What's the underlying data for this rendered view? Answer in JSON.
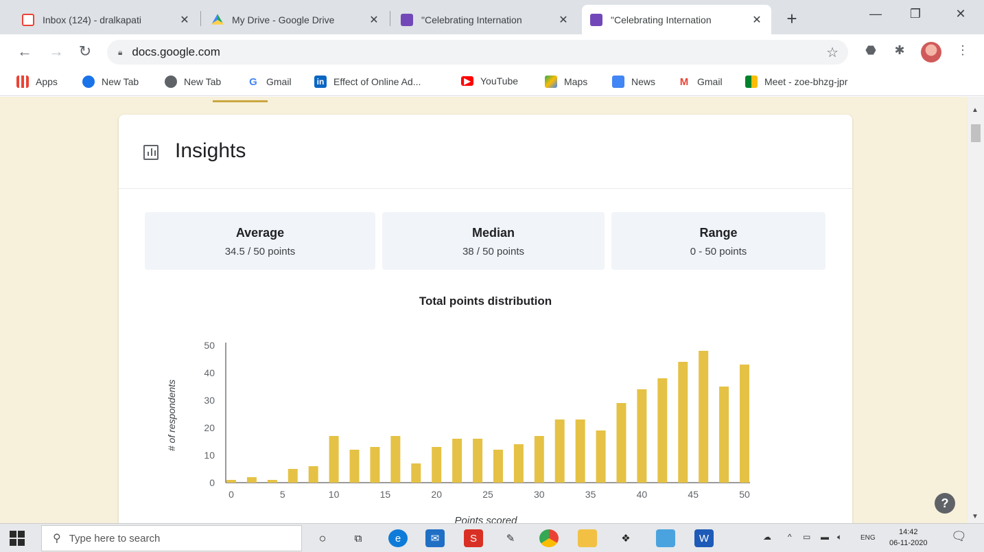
{
  "browser": {
    "tabs": [
      {
        "title": "Inbox (124) - dralkapati",
        "icon": "gmail-icon",
        "color": "#ea4335"
      },
      {
        "title": "My Drive - Google Drive",
        "icon": "google-drive-icon",
        "color": "#1fa463"
      },
      {
        "title": "\"Celebrating Internation",
        "icon": "google-forms-icon",
        "color": "#7248b9"
      },
      {
        "title": "\"Celebrating Internation",
        "icon": "google-forms-icon",
        "color": "#7248b9"
      }
    ],
    "url": "docs.google.com",
    "bookmarks": [
      {
        "label": "Apps",
        "icon": "apps-grid-icon",
        "color": "#ea4335"
      },
      {
        "label": "New Tab",
        "icon": "gear-icon",
        "color": "#1a73e8"
      },
      {
        "label": "New Tab",
        "icon": "globe-icon",
        "color": "#5f6368"
      },
      {
        "label": "Gmail",
        "icon": "google-g-icon",
        "color": "#4285f4"
      },
      {
        "label": "Effect of Online Ad...",
        "icon": "linkedin-icon",
        "color": "#0a66c2"
      },
      {
        "label": "YouTube",
        "icon": "youtube-icon",
        "color": "#ff0000"
      },
      {
        "label": "Maps",
        "icon": "maps-icon",
        "color": "#34a853"
      },
      {
        "label": "News",
        "icon": "news-icon",
        "color": "#4285f4"
      },
      {
        "label": "Gmail",
        "icon": "gmail-icon",
        "color": "#ea4335"
      },
      {
        "label": "Meet - zoe-bhzg-jpr",
        "icon": "meet-icon",
        "color": "#00832d"
      }
    ]
  },
  "insights": {
    "title": "Insights",
    "stats": [
      {
        "label": "Average",
        "value": "34.5 / 50 points"
      },
      {
        "label": "Median",
        "value": "38 / 50 points"
      },
      {
        "label": "Range",
        "value": "0 - 50 points"
      }
    ]
  },
  "chart_data": {
    "type": "bar",
    "title": "Total points distribution",
    "xlabel": "Points scored",
    "ylabel": "# of respondents",
    "ylim": [
      0,
      50
    ],
    "yticks": [
      0,
      10,
      20,
      30,
      40,
      50
    ],
    "xticks": [
      0,
      5,
      10,
      15,
      20,
      25,
      30,
      35,
      40,
      45,
      50
    ],
    "bar_color": "#e5c245",
    "x": [
      0,
      2,
      4,
      6,
      8,
      10,
      12,
      14,
      16,
      18,
      20,
      22,
      24,
      26,
      28,
      30,
      32,
      34,
      36,
      38,
      40,
      42,
      44,
      46,
      48,
      50
    ],
    "values": [
      1,
      2,
      1,
      5,
      6,
      17,
      12,
      13,
      17,
      7,
      13,
      16,
      16,
      12,
      14,
      17,
      23,
      23,
      19,
      29,
      34,
      38,
      44,
      48,
      35,
      43
    ]
  },
  "taskbar": {
    "search_placeholder": "Type here to search",
    "language": "ENG",
    "time": "14:42",
    "date": "06-11-2020"
  }
}
